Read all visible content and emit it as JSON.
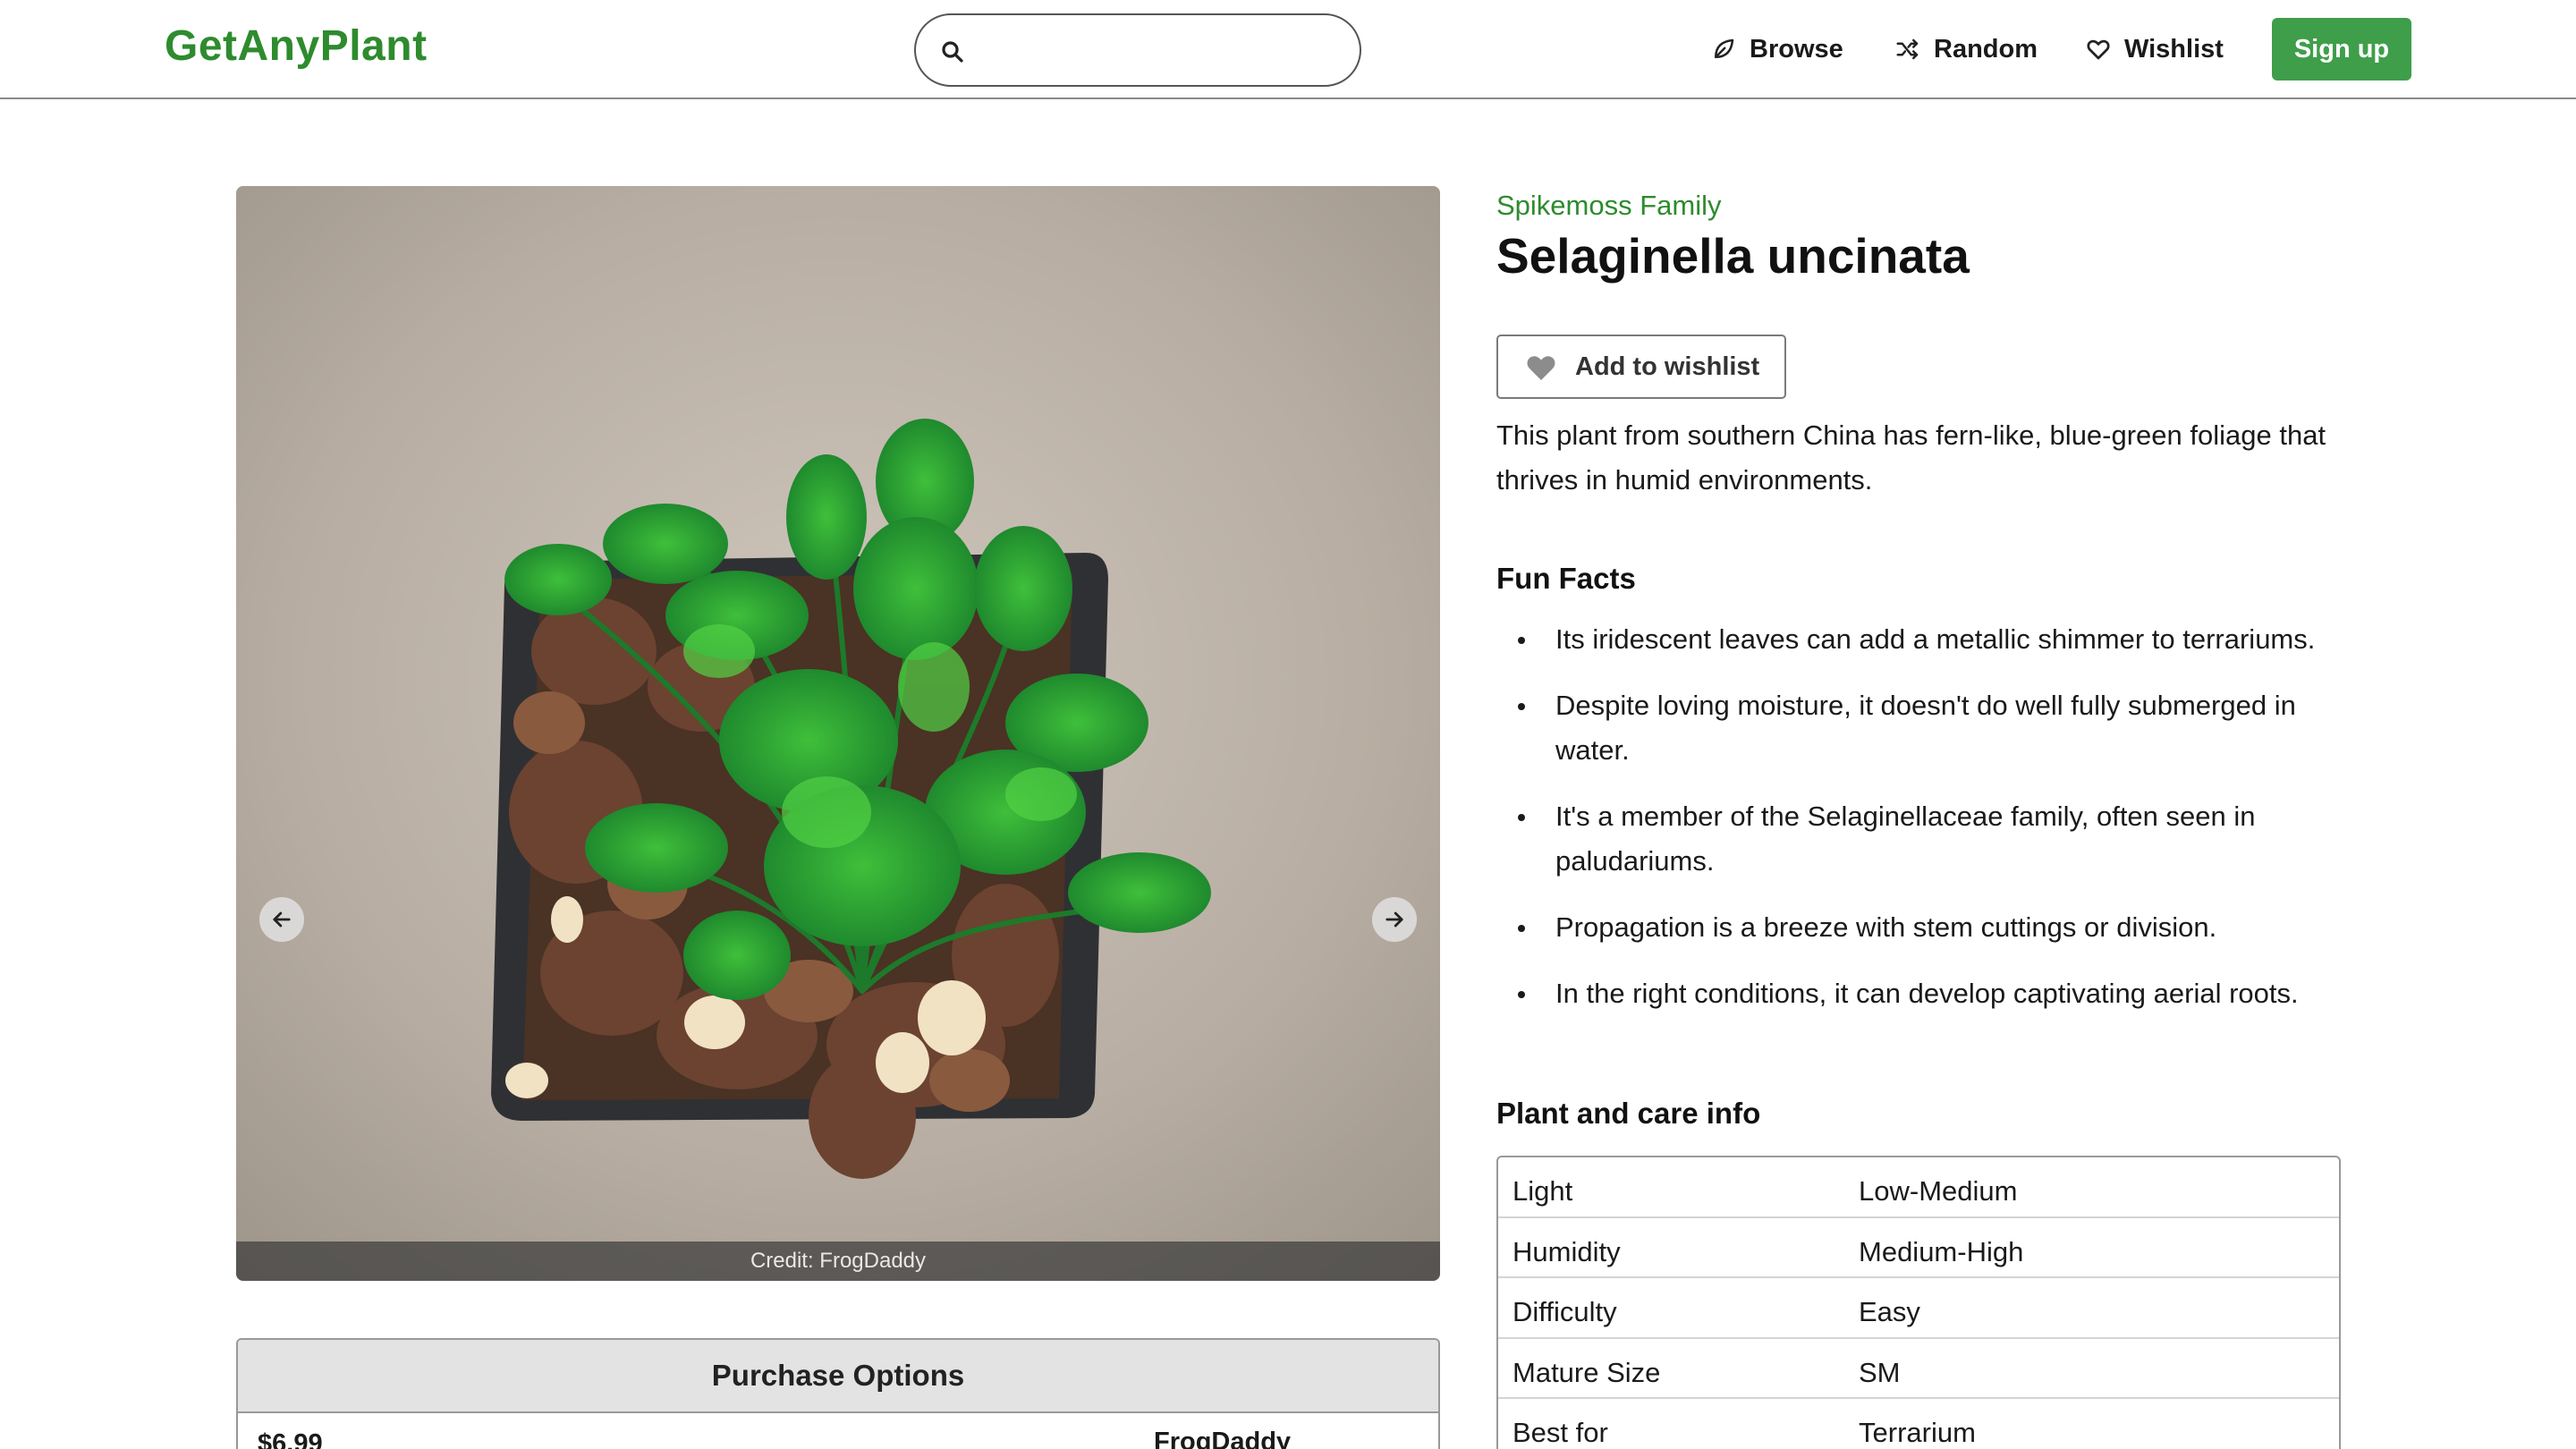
{
  "header": {
    "logo": "GetAnyPlant",
    "search_value": "",
    "nav": {
      "browse": "Browse",
      "random": "Random",
      "wishlist": "Wishlist"
    },
    "signup": "Sign up"
  },
  "gallery": {
    "credit": "Credit: FrogDaddy"
  },
  "plant": {
    "family": "Spikemoss Family",
    "name": "Selaginella uncinata",
    "wishlist_button": "Add to wishlist",
    "description": "This plant from southern China has fern-like, blue-green foliage that thrives in humid environments."
  },
  "fun_facts": {
    "heading": "Fun Facts",
    "items": [
      "Its iridescent leaves can add a metallic shimmer to terrariums.",
      "Despite loving moisture, it doesn't do well fully submerged in water.",
      "It's a member of the Selaginellaceae family, often seen in paludariums.",
      "Propagation is a breeze with stem cuttings or division.",
      "In the right conditions, it can develop captivating aerial roots."
    ]
  },
  "care": {
    "heading": "Plant and care info",
    "rows": [
      {
        "label": "Light",
        "value": "Low-Medium"
      },
      {
        "label": "Humidity",
        "value": "Medium-High"
      },
      {
        "label": "Difficulty",
        "value": "Easy"
      },
      {
        "label": "Mature Size",
        "value": "SM"
      },
      {
        "label": "Best for",
        "value": "Terrarium"
      }
    ]
  },
  "purchase": {
    "heading": "Purchase Options",
    "price": "$6.99",
    "seller": "FrogDaddy"
  },
  "colors": {
    "brand_green": "#2e8b2e",
    "button_green": "#3f9e4a"
  },
  "icons": {
    "search": "search-icon",
    "browse": "leaf-icon",
    "random": "shuffle-icon",
    "wishlist": "heart-outline-icon",
    "add_wishlist": "heart-filled-icon",
    "prev": "arrow-left-icon",
    "next": "arrow-right-icon"
  }
}
